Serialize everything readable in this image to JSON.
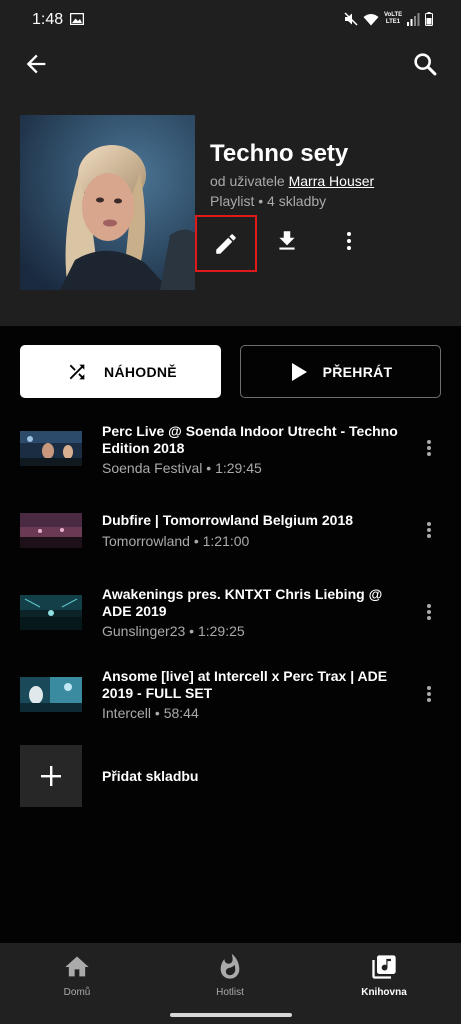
{
  "status_bar": {
    "time": "1:48",
    "network": "VoLTE LTE1"
  },
  "playlist": {
    "title": "Techno sety",
    "owner_prefix": "od uživatele",
    "owner_name": "Marra Houser",
    "meta": "Playlist • 4 skladby"
  },
  "actions": {
    "shuffle_label": "NÁHODNĚ",
    "play_label": "PŘEHRÁT"
  },
  "tracks": [
    {
      "title": "Perc Live @ Soenda Indoor Utrecht - Techno Edition 2018",
      "subtitle": "Soenda Festival • 1:29:45"
    },
    {
      "title": "Dubfire | Tomorrowland Belgium 2018",
      "subtitle": "Tomorrowland • 1:21:00"
    },
    {
      "title": "Awakenings pres. KNTXT Chris Liebing @ ADE 2019",
      "subtitle": "Gunslinger23 • 1:29:25"
    },
    {
      "title": "Ansome [live] at Intercell x Perc Trax | ADE 2019 - FULL SET",
      "subtitle": "Intercell • 58:44"
    }
  ],
  "add_track_label": "Přidat skladbu",
  "nav": [
    {
      "label": "Domů",
      "icon": "home-icon"
    },
    {
      "label": "Hotlist",
      "icon": "flame-icon"
    },
    {
      "label": "Knihovna",
      "icon": "library-icon",
      "active": true
    }
  ],
  "colors": {
    "background": "#030303",
    "header": "#1f1f1f",
    "highlight_box": "#e0191a",
    "secondary_text": "#aaaaaa",
    "nav_bg": "#212121"
  }
}
